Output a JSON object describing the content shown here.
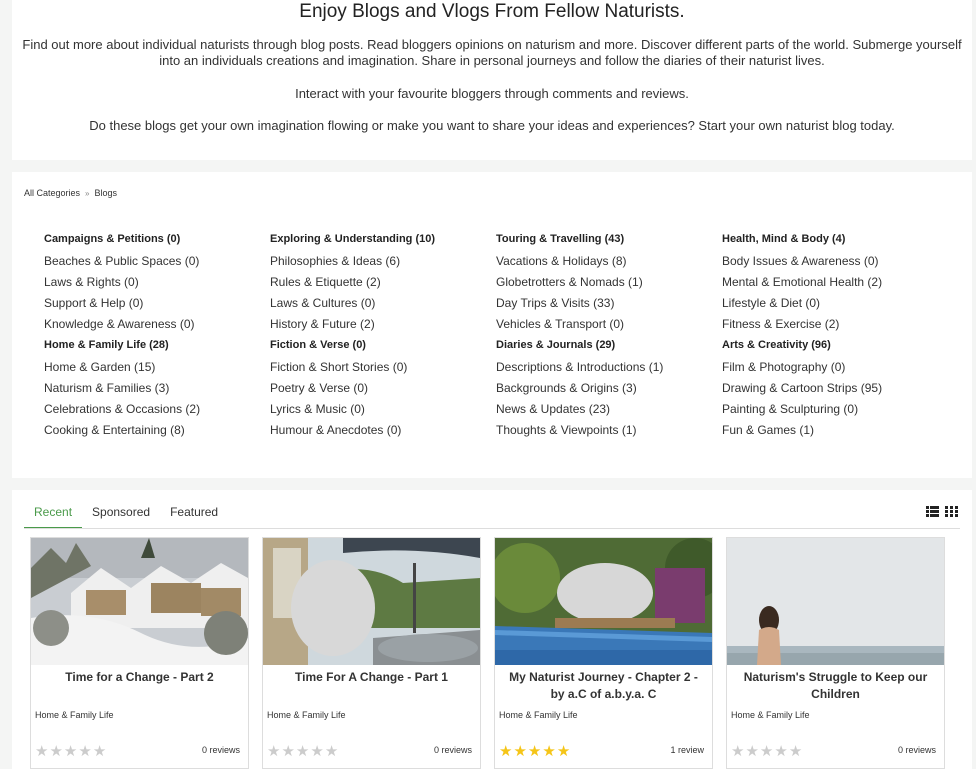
{
  "intro": {
    "title": "Enjoy Blogs and Vlogs From Fellow Naturists.",
    "p1": "Find out more about individual naturists through blog posts. Read bloggers opinions on naturism and more. Discover different parts of the world. Submerge yourself into an individuals creations and imagination. Share in personal journeys and follow the diaries of their naturist lives.",
    "p2": "Interact with your favourite bloggers through comments and reviews.",
    "p3": "Do these blogs get your own imagination flowing or make you want to share your ideas and experiences? Start your own naturist blog today."
  },
  "breadcrumb": {
    "root": "All Categories",
    "sep": "»",
    "current": "Blogs"
  },
  "columns": [
    [
      {
        "label": "Campaigns & Petitions (0)",
        "head": true
      },
      {
        "label": "Beaches & Public Spaces (0)"
      },
      {
        "label": "Laws & Rights (0)"
      },
      {
        "label": "Support & Help (0)"
      },
      {
        "label": "Knowledge & Awareness (0)"
      },
      {
        "label": "Home & Family Life (28)",
        "head": true
      },
      {
        "label": "Home & Garden (15)"
      },
      {
        "label": "Naturism & Families (3)"
      },
      {
        "label": "Celebrations & Occasions (2)"
      },
      {
        "label": "Cooking & Entertaining (8)"
      }
    ],
    [
      {
        "label": "Exploring & Understanding (10)",
        "head": true
      },
      {
        "label": "Philosophies & Ideas (6)"
      },
      {
        "label": "Rules & Etiquette (2)"
      },
      {
        "label": "Laws & Cultures (0)"
      },
      {
        "label": "History & Future (2)"
      },
      {
        "label": "Fiction & Verse (0)",
        "head": true
      },
      {
        "label": "Fiction & Short Stories (0)"
      },
      {
        "label": "Poetry & Verse (0)"
      },
      {
        "label": "Lyrics & Music (0)"
      },
      {
        "label": "Humour & Anecdotes (0)"
      }
    ],
    [
      {
        "label": "Touring & Travelling (43)",
        "head": true
      },
      {
        "label": "Vacations & Holidays (8)"
      },
      {
        "label": "Globetrotters & Nomads (1)"
      },
      {
        "label": "Day Trips & Visits (33)"
      },
      {
        "label": "Vehicles & Transport (0)"
      },
      {
        "label": "Diaries & Journals (29)",
        "head": true
      },
      {
        "label": "Descriptions & Introductions (1)"
      },
      {
        "label": "Backgrounds & Origins (3)"
      },
      {
        "label": "News & Updates (23)"
      },
      {
        "label": "Thoughts & Viewpoints (1)"
      }
    ],
    [
      {
        "label": "Health, Mind & Body (4)",
        "head": true
      },
      {
        "label": "Body Issues & Awareness (0)"
      },
      {
        "label": "Mental & Emotional Health (2)"
      },
      {
        "label": "Lifestyle & Diet (0)"
      },
      {
        "label": "Fitness & Exercise (2)"
      },
      {
        "label": "Arts & Creativity (96)",
        "head": true
      },
      {
        "label": "Film & Photography (0)"
      },
      {
        "label": "Drawing & Cartoon Strips (95)"
      },
      {
        "label": "Painting & Sculpturing (0)"
      },
      {
        "label": "Fun & Games (1)"
      }
    ]
  ],
  "tabs": [
    "Recent",
    "Sponsored",
    "Featured"
  ],
  "icons": {
    "list_view": "list-view-icon",
    "grid_view": "grid-view-icon",
    "star": "star-icon"
  },
  "colors": {
    "accent": "#4a9a4a",
    "star_on": "#f5c518",
    "star_off": "#cccccc"
  },
  "cards": [
    {
      "title": "Time for a Change - Part 2",
      "category": "Home & Family Life",
      "rating": 0,
      "reviews": "0 reviews"
    },
    {
      "title": "Time For A Change - Part 1",
      "category": "Home & Family Life",
      "rating": 0,
      "reviews": "0 reviews"
    },
    {
      "title": "My Naturist Journey - Chapter 2 - by a.C of a.b.y.a. C",
      "category": "Home & Family Life",
      "rating": 5,
      "reviews": "1 review"
    },
    {
      "title": "Naturism's Struggle to Keep our Children",
      "category": "Home & Family Life",
      "rating": 0,
      "reviews": "0 reviews"
    }
  ]
}
